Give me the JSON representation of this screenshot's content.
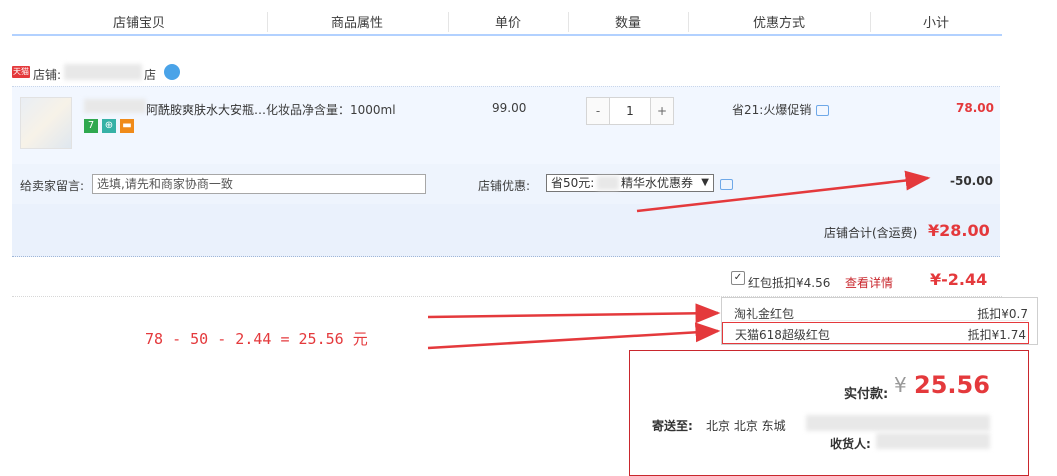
{
  "header": {
    "shop_item": "店铺宝贝",
    "attrs": "商品属性",
    "price": "单价",
    "qty": "数量",
    "discount": "优惠方式",
    "subtotal": "小计"
  },
  "shop": {
    "tmall_badge": "天猫",
    "label": "店铺:",
    "suffix": "店"
  },
  "item": {
    "title": "阿酰胺爽肤水大安瓶…",
    "attr": "化妆品净含量：1000ml",
    "price": "99.00",
    "qty_minus": "-",
    "qty_value": "1",
    "qty_plus": "+",
    "promo": "省21:火爆促销",
    "subtotal": "78.00",
    "tags": [
      "7",
      "⊕",
      "▬"
    ]
  },
  "message": {
    "label": "给卖家留言:",
    "placeholder": "选填,请先和商家协商一致"
  },
  "shop_discount": {
    "label": "店铺优惠:",
    "selected_prefix": "省50元:",
    "selected_suffix": "精华水优惠券",
    "amount": "-50.00"
  },
  "shop_total": {
    "label": "店铺合计(含运费)",
    "value": "¥28.00"
  },
  "red_packet": {
    "label": "红包抵扣¥4.56",
    "link": "查看详情",
    "amount": "¥-2.44",
    "popup": [
      {
        "name": "淘礼金红包",
        "value": "抵扣¥0.7"
      },
      {
        "name": "天猫618超级红包",
        "value": "抵扣¥1.74"
      }
    ]
  },
  "annotation": "78 - 50 - 2.44 = 25.56 元",
  "payment": {
    "label": "实付款:",
    "currency": "¥",
    "amount": "25.56",
    "ship_label": "寄送至:",
    "address": "北京 北京 东城",
    "receiver_label": "收货人:"
  },
  "colors": {
    "accent_red": "#e4393c",
    "header_line": "#b2d1ff",
    "arrow_red": "#e4393c"
  }
}
